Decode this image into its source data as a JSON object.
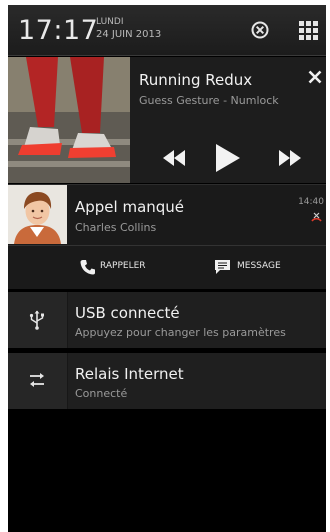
{
  "status_bar": {
    "time": "17:17",
    "day": "LUNDI",
    "date": "24 JUIN 2013",
    "icons": [
      "clear-all-icon",
      "quick-settings-grid-icon"
    ]
  },
  "media": {
    "title": "Running Redux",
    "artist": "Guess Gesture - Numlock",
    "controls": [
      "previous-icon",
      "play-icon",
      "next-icon"
    ]
  },
  "missed_call": {
    "title": "Appel manqué",
    "caller": "Charles Collins",
    "time": "14:40",
    "actions": [
      {
        "label": "RAPPELER",
        "icon": "phone-icon"
      },
      {
        "label": "MESSAGE",
        "icon": "message-icon"
      }
    ]
  },
  "usb": {
    "title": "USB connecté",
    "subtitle": "Appuyez pour changer les paramètres",
    "icon": "usb-icon"
  },
  "relay": {
    "title": "Relais Internet",
    "subtitle": "Connecté",
    "icon": "transfer-arrows-icon"
  },
  "colors": {
    "background": "#000000",
    "card": "#1f1f1f",
    "missed_call_icon": "#e03a2a"
  }
}
